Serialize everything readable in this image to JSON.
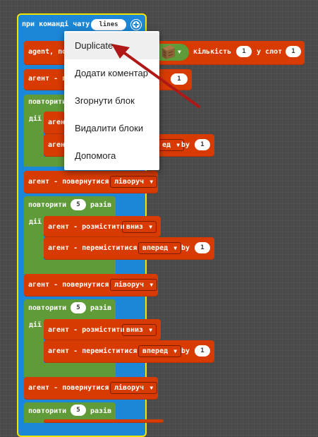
{
  "event_block": {
    "label": "при команді чату",
    "value": "lines",
    "add_icon": "plus-circle-icon"
  },
  "give_block": {
    "label": "agent, по",
    "amount_label": "кількість",
    "amount": "1",
    "slot_label": "у слот",
    "slot": "1",
    "item_icon": "wood-block-icon"
  },
  "agent_label_cut": "агент - п",
  "agent_cut_value": "1",
  "loop_label_cut": "повторити",
  "body_label": "дії",
  "agent_prefix_cut": "агент",
  "agent_label_pl": "агент - розмістити",
  "agent_label_move": "агент - переміститися",
  "agent_label_turn": "агент - повернутися",
  "dir_down": "вниз",
  "dir_forward": "вперед",
  "dir_left": "ліворуч",
  "dir_forward_cut": "ед",
  "by_label": "by",
  "repeat_label": "повторити",
  "times_label": "разів",
  "loop_count": "5",
  "step_value": "1",
  "context_menu": {
    "items": [
      "Duplicate",
      "Додати коментар",
      "Згорнути блок",
      "Видалити блоки",
      "Допомога"
    ],
    "selected": "Duplicate"
  },
  "colors": {
    "background": "#4a4a4a",
    "event": "#1c87d6",
    "loop": "#5f9b38",
    "agent": "#d83b01",
    "highlight": "#f2e600",
    "arrow": "#b01818"
  }
}
